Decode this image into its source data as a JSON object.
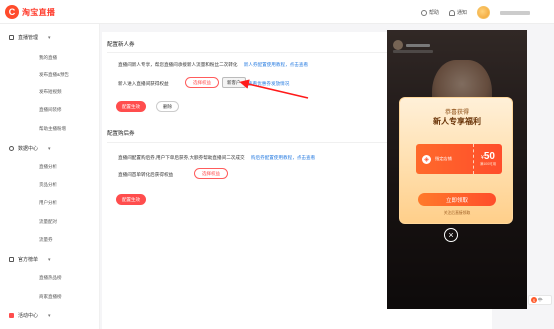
{
  "header": {
    "logo_glyph": "C",
    "logo_text": "淘宝直播",
    "help_label": "帮助",
    "notify_label": "通知"
  },
  "sidebar": {
    "groups": [
      {
        "label": "直播管理",
        "icon": "grid-icon",
        "items": [
          "我的直播",
          "发布直播&预告",
          "发布短视频",
          "直播间装修",
          "帮助主播粉增"
        ]
      },
      {
        "label": "数据中心",
        "icon": "chart-icon",
        "items": [
          "直播分析",
          "货品分析",
          "用户分析",
          "流量配对",
          "流量券"
        ]
      },
      {
        "label": "官方榜单",
        "icon": "trophy-icon",
        "items": [
          "直播热品榜",
          "商家直播榜"
        ]
      },
      {
        "label": "活动中心",
        "icon": "gift-icon",
        "items": []
      }
    ]
  },
  "main": {
    "section1": {
      "title": "配置新人券",
      "desc": "直播间新人专享，帮您直播间承接新人流量和粉丝二次转化",
      "desc_link": "新人券配置使用教程，点击查看",
      "row_label": "新人进入直播间获得权益",
      "select_btn": "选择权益",
      "tag_btn": "新客户",
      "tag_link": "查看优惠券发放情况",
      "save_btn": "配置生效",
      "delete_btn": "删除"
    },
    "section2": {
      "title": "配置购后券",
      "desc": "直播间配置购后券,用户下单后获券,大额券帮助直播间二次成交",
      "desc_link": "购后券配置使用教程，点击查看",
      "row_label": "直播间首单转化后获得权益",
      "select_btn": "选择权益",
      "save_btn": "配置生效"
    }
  },
  "preview": {
    "modal_title": "恭喜获得",
    "modal_subtitle": "新人专享福利",
    "coupon_label": "指定店铺",
    "coupon_currency": "¥",
    "coupon_amount": "50",
    "coupon_condition": "满100可用",
    "claim_btn": "立即领取",
    "footer_note": "关注后直接领取",
    "close_glyph": "×"
  },
  "ime": {
    "glyph": "S",
    "text": "中·"
  },
  "colors": {
    "brand": "#ff3d2e",
    "accent_red": "#ff4d4d",
    "link_blue": "#2a7de1"
  }
}
